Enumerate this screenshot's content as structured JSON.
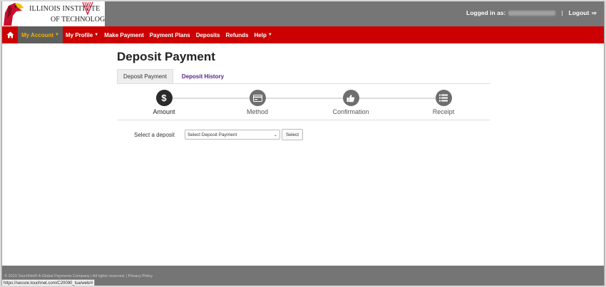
{
  "header": {
    "logo_line1": "ILLINOIS INSTITUTE",
    "logo_line2": "OF TECHNOLOGY",
    "logged_in_label": "Logged in as:",
    "logout_label": "Logout"
  },
  "nav": {
    "items": [
      {
        "label": "My Account",
        "dropdown": true
      },
      {
        "label": "My Profile",
        "dropdown": true
      },
      {
        "label": "Make Payment",
        "dropdown": false
      },
      {
        "label": "Payment Plans",
        "dropdown": false
      },
      {
        "label": "Deposits",
        "dropdown": false
      },
      {
        "label": "Refunds",
        "dropdown": false
      },
      {
        "label": "Help",
        "dropdown": true
      }
    ]
  },
  "main": {
    "title": "Deposit Payment",
    "tabs": [
      {
        "label": "Deposit Payment"
      },
      {
        "label": "Deposit History"
      }
    ],
    "steps": [
      {
        "label": "Amount",
        "icon": "$"
      },
      {
        "label": "Method",
        "icon": "credit-card-icon"
      },
      {
        "label": "Confirmation",
        "icon": "thumbs-up-icon"
      },
      {
        "label": "Receipt",
        "icon": "list-icon"
      }
    ],
    "deposit_label": "Select a deposit",
    "select_value": "Select Deposit Payment",
    "select_button": "Select"
  },
  "footer": {
    "copyright": "© 2023 TouchNet® A Global Payments Company | All rights reserved. | Privacy Policy"
  },
  "status_url": "https://secure.touchnet.com/C20090_tsa/web/#",
  "colors": {
    "header_gray": "#767676",
    "nav_red": "#cc0000",
    "active_nav_bg": "#5e5e5e",
    "active_nav_text": "#f0b400",
    "tab_link": "#5a1e8a"
  }
}
